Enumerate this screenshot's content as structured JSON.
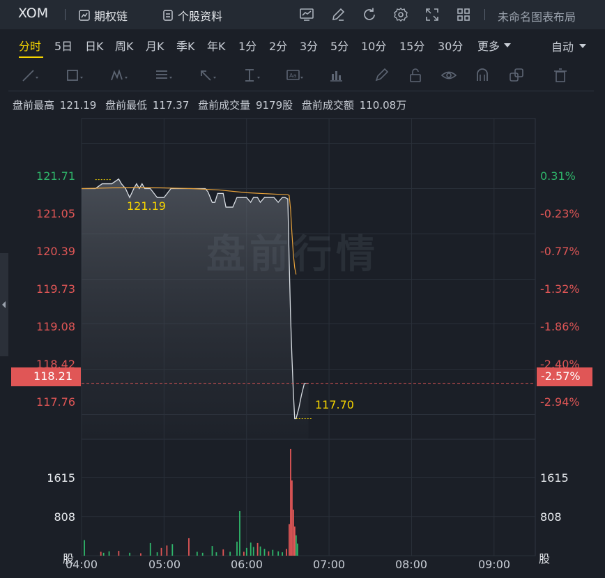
{
  "header": {
    "ticker": "XOM",
    "options_chain_label": "期权链",
    "profile_label": "个股资料",
    "layout_label": "未命名图表布局",
    "tool_icons": [
      "chart-type-icon",
      "draw-pen-icon",
      "refresh-icon",
      "settings-gear-icon",
      "fullscreen-icon",
      "grid-layout-icon"
    ]
  },
  "periods": {
    "tabs": [
      "分时",
      "5日",
      "日K",
      "周K",
      "月K",
      "季K",
      "年K",
      "1分",
      "2分",
      "3分",
      "5分",
      "10分",
      "15分",
      "30分",
      "更多"
    ],
    "active": "分时",
    "mode_label": "自动"
  },
  "drawing_tools": [
    "line-tool-icon",
    "rect-tool-icon",
    "pattern-tool-icon",
    "fib-tool-icon",
    "arrow-tool-icon",
    "measure-tool-icon",
    "text-tool-icon",
    "bars-tool-icon",
    "brush-icon",
    "lock-icon",
    "eye-icon",
    "magnet-icon",
    "clone-icon",
    "trash-icon"
  ],
  "stats": {
    "high_label": "盘前最高",
    "high_value": "121.19",
    "low_label": "盘前最低",
    "low_value": "117.37",
    "volume_label": "盘前成交量",
    "volume_value": "9179股",
    "amount_label": "盘前成交额",
    "amount_value": "110.08万"
  },
  "colors": {
    "up": "#2fb56a",
    "down": "#e05656",
    "price_line": "#d8dde3",
    "avg_line": "#e8a23a",
    "highlight": "#f5d400"
  },
  "chart_data": {
    "type": "line",
    "watermark": "盘前行情",
    "x_labels": [
      "04:00",
      "05:00",
      "06:00",
      "07:00",
      "08:00",
      "09:00"
    ],
    "xlim_minutes": [
      0,
      330
    ],
    "price_axis": {
      "left_ticks": [
        "121.71",
        "121.05",
        "120.39",
        "119.73",
        "119.08",
        "118.42",
        "117.76"
      ],
      "right_ticks": [
        "0.31%",
        "-0.23%",
        "-0.77%",
        "-1.32%",
        "-1.86%",
        "-2.40%",
        "-2.94%"
      ],
      "ylim": [
        117.4,
        122.07
      ]
    },
    "current_price": {
      "value": "118.21",
      "change": "-2.57%"
    },
    "high_marker": "121.19",
    "low_marker": "117.70",
    "price_series": {
      "minutes": [
        0,
        10,
        15,
        18,
        22,
        27,
        29,
        32,
        35,
        38,
        40,
        42,
        44,
        46,
        48,
        50,
        55,
        60,
        65,
        70,
        75,
        78,
        80,
        82,
        84,
        86,
        88,
        90,
        92,
        95,
        97,
        99,
        101,
        103,
        105,
        110,
        113,
        115,
        118,
        120,
        123,
        125,
        128,
        130,
        133,
        135,
        138,
        140,
        143,
        146,
        148,
        150,
        151,
        152,
        153,
        154,
        155,
        156,
        158,
        160,
        162,
        165
      ],
      "values": [
        121.05,
        121.05,
        121.12,
        121.12,
        121.12,
        121.19,
        121.12,
        121.05,
        120.92,
        121.05,
        121.12,
        121.05,
        121.12,
        121.05,
        121.05,
        121.05,
        120.92,
        120.92,
        121.05,
        121.05,
        121.05,
        121.05,
        121.05,
        121.05,
        121.05,
        121.05,
        121.05,
        121.05,
        121.0,
        120.85,
        120.85,
        120.98,
        120.98,
        120.98,
        120.78,
        120.78,
        120.92,
        120.92,
        120.92,
        120.92,
        120.85,
        120.92,
        120.92,
        120.85,
        120.92,
        120.92,
        120.92,
        120.92,
        120.85,
        120.92,
        120.92,
        120.9,
        120.0,
        119.2,
        118.6,
        118.1,
        117.7,
        117.7,
        117.85,
        118.05,
        118.21,
        118.21
      ]
    },
    "avg_series": {
      "minutes": [
        0,
        20,
        40,
        60,
        80,
        100,
        120,
        140,
        150,
        151,
        152,
        153,
        154,
        155,
        156
      ],
      "values": [
        121.05,
        121.06,
        121.07,
        121.06,
        121.05,
        121.03,
        120.99,
        120.97,
        120.96,
        120.95,
        120.75,
        120.4,
        120.1,
        119.9,
        119.8
      ]
    },
    "volume_axis": {
      "ticks": [
        "1615",
        "808"
      ],
      "unit": "股",
      "ylim": [
        0,
        2400
      ]
    },
    "volume_bars": [
      {
        "m": 2,
        "v": 320,
        "c": "up"
      },
      {
        "m": 14,
        "v": 80,
        "c": "down"
      },
      {
        "m": 16,
        "v": 60,
        "c": "up"
      },
      {
        "m": 20,
        "v": 90,
        "c": "up"
      },
      {
        "m": 27,
        "v": 100,
        "c": "down"
      },
      {
        "m": 35,
        "v": 60,
        "c": "up"
      },
      {
        "m": 43,
        "v": 50,
        "c": "down"
      },
      {
        "m": 50,
        "v": 260,
        "c": "up"
      },
      {
        "m": 55,
        "v": 70,
        "c": "up"
      },
      {
        "m": 58,
        "v": 160,
        "c": "down"
      },
      {
        "m": 62,
        "v": 210,
        "c": "down"
      },
      {
        "m": 66,
        "v": 240,
        "c": "up"
      },
      {
        "m": 78,
        "v": 360,
        "c": "down"
      },
      {
        "m": 84,
        "v": 80,
        "c": "up"
      },
      {
        "m": 88,
        "v": 60,
        "c": "up"
      },
      {
        "m": 95,
        "v": 200,
        "c": "up"
      },
      {
        "m": 98,
        "v": 70,
        "c": "up"
      },
      {
        "m": 103,
        "v": 130,
        "c": "down"
      },
      {
        "m": 108,
        "v": 80,
        "c": "up"
      },
      {
        "m": 113,
        "v": 290,
        "c": "up"
      },
      {
        "m": 115,
        "v": 920,
        "c": "up"
      },
      {
        "m": 118,
        "v": 80,
        "c": "down"
      },
      {
        "m": 120,
        "v": 160,
        "c": "up"
      },
      {
        "m": 123,
        "v": 270,
        "c": "up"
      },
      {
        "m": 125,
        "v": 180,
        "c": "up"
      },
      {
        "m": 128,
        "v": 260,
        "c": "down"
      },
      {
        "m": 130,
        "v": 190,
        "c": "up"
      },
      {
        "m": 133,
        "v": 140,
        "c": "up"
      },
      {
        "m": 136,
        "v": 90,
        "c": "down"
      },
      {
        "m": 139,
        "v": 120,
        "c": "up"
      },
      {
        "m": 143,
        "v": 90,
        "c": "up"
      },
      {
        "m": 146,
        "v": 70,
        "c": "up"
      },
      {
        "m": 149,
        "v": 140,
        "c": "down"
      },
      {
        "m": 151,
        "v": 650,
        "c": "down"
      },
      {
        "m": 152,
        "v": 2200,
        "c": "down"
      },
      {
        "m": 153,
        "v": 1550,
        "c": "down"
      },
      {
        "m": 154,
        "v": 950,
        "c": "down"
      },
      {
        "m": 155,
        "v": 600,
        "c": "down"
      },
      {
        "m": 156,
        "v": 420,
        "c": "up"
      },
      {
        "m": 157,
        "v": 250,
        "c": "up"
      }
    ]
  }
}
